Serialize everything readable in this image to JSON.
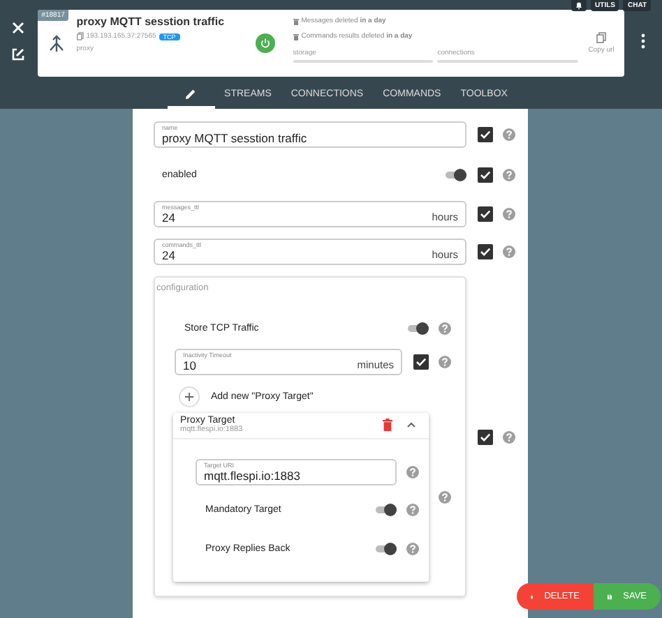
{
  "top_buttons": [
    "UTILS",
    "CHAT"
  ],
  "card": {
    "id": "#18817",
    "title": "proxy MQTT sesstion traffic",
    "address": "193.193.165.37:27565",
    "protocol": "TCP",
    "type": "proxy",
    "running": true,
    "notes": [
      "Messages deleted **in a day**",
      "Commands results deleted **in a day**"
    ],
    "meters": [
      {
        "label": "storage",
        "level": 0
      },
      {
        "label": "connections",
        "level": 0
      }
    ],
    "copy_label": "Copy url"
  },
  "tabs": [
    {
      "kind": "icon",
      "selected": true
    },
    {
      "label": "STREAMS",
      "selected": false
    },
    {
      "label": "CONNECTIONS",
      "selected": false
    },
    {
      "label": "COMMANDS",
      "selected": false
    },
    {
      "label": "TOOLBOX",
      "selected": false
    }
  ],
  "form": [
    {
      "kind": "text",
      "label": "name",
      "value": "proxy MQTT sesstion traffic",
      "checked": true
    },
    {
      "kind": "toggle",
      "label": "enabled",
      "on": true,
      "checked": true
    },
    {
      "kind": "text",
      "label": "messages_ttl",
      "value": "24",
      "suffix": "hours",
      "checked": true
    },
    {
      "kind": "text",
      "label": "commands_ttl",
      "value": "24",
      "suffix": "hours",
      "checked": true
    },
    {
      "kind": "group",
      "label": "configuration",
      "checked": true,
      "items": [
        {
          "kind": "toggle",
          "label": "Store TCP Traffic",
          "on": true
        },
        {
          "kind": "text",
          "label": "Inactivity Timeout",
          "value": "10",
          "suffix": "minutes",
          "checked": true
        },
        {
          "kind": "add",
          "label": "Add new \"Proxy Target\""
        },
        {
          "kind": "target",
          "title": "Proxy Target",
          "subtitle": "mqtt.flespi.io:1883",
          "expanded": true,
          "items": [
            {
              "kind": "text",
              "label": "Target URI",
              "value": "mqtt.flespi.io:1883"
            },
            {
              "kind": "toggle",
              "label": "Mandatory Target",
              "on": true
            },
            {
              "kind": "toggle",
              "label": "Proxy Replies Back",
              "on": true
            }
          ]
        }
      ]
    }
  ],
  "actions": [
    {
      "kind": "delete",
      "label": "DELETE"
    },
    {
      "kind": "save",
      "label": "SAVE"
    }
  ]
}
